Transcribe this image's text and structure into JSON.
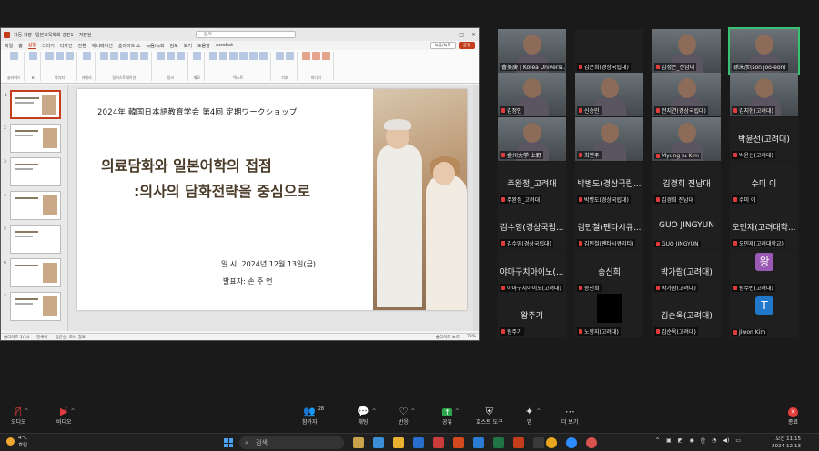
{
  "ppt": {
    "autosave": "자동 저장",
    "filename": "일본교육학회 강진1 • 저장됨",
    "search_placeholder": "검색",
    "tabs": [
      "파일",
      "홈",
      "삽입",
      "그리기",
      "디자인",
      "전환",
      "애니메이션",
      "슬라이드 쇼",
      "녹음/녹화",
      "검토",
      "보기",
      "도움말",
      "Acrobat"
    ],
    "active_tab": "삽입",
    "record_button": "녹음/녹화",
    "share_button": "공유",
    "ribbon_groups": [
      "슬라이드",
      "표",
      "이미지",
      "카메라",
      "일러스트레이션",
      "링크",
      "메모",
      "텍스트",
      "기호",
      "미디어"
    ],
    "status_slide": "슬라이드 1/14",
    "status_lang": "한국어",
    "status_a11y": "접근성: 조사 필요",
    "status_notes": "슬라이드 노트",
    "status_zoom": "70%"
  },
  "slide": {
    "conference": "2024年  韓国日本語教育学会  第4回  定期ワークショップ",
    "title_line1": "의료담화와 일본어학의 접점",
    "title_line2": ":의사의 담화전략을 중심으로",
    "date_line": "일   시: 2024년 12월 13일(금)",
    "presenter_line": "발표자: 손 주 언"
  },
  "thumbnails": [
    "1",
    "2",
    "3",
    "4",
    "5",
    "6",
    "7"
  ],
  "gallery": {
    "tiles": [
      {
        "name": "",
        "label": "曹美庚 | Korea Universi...",
        "video": true,
        "muted": false,
        "speaking": false
      },
      {
        "name": "",
        "label": "김은희(경상국립대)",
        "video": false,
        "muted": true,
        "speaking": false
      },
      {
        "name": "",
        "label": "김성은_전남대",
        "video": true,
        "muted": true,
        "speaking": false
      },
      {
        "name": "",
        "label": "孫朱彦(son joo-eon)",
        "video": true,
        "muted": false,
        "speaking": true
      },
      {
        "name": "",
        "label": "김정인",
        "video": true,
        "muted": true,
        "speaking": false
      },
      {
        "name": "",
        "label": "신승민",
        "video": true,
        "muted": true,
        "speaking": false
      },
      {
        "name": "",
        "label": "전지연(경상국립대)",
        "video": true,
        "muted": true,
        "speaking": false
      },
      {
        "name": "",
        "label": "김지현(고려대)",
        "video": true,
        "muted": true,
        "speaking": false
      },
      {
        "name": "",
        "label": "金州大学  上野",
        "video": true,
        "muted": true,
        "speaking": false
      },
      {
        "name": "",
        "label": "최연주",
        "video": true,
        "muted": true,
        "speaking": false
      },
      {
        "name": "",
        "label": "Myung Ju Kim",
        "video": true,
        "muted": true,
        "speaking": false
      },
      {
        "name": "박윤선(고려대)",
        "label": "박윤선(고려대)",
        "video": false,
        "muted": true,
        "speaking": false
      },
      {
        "name": "주완정_고려대",
        "label": "주완정_고려대",
        "video": false,
        "muted": true,
        "speaking": false
      },
      {
        "name": "박병도(경상국립...",
        "label": "박병도(경상국립대)",
        "video": false,
        "muted": true,
        "speaking": false
      },
      {
        "name": "김경희 전남대",
        "label": "김경희 전남대",
        "video": false,
        "muted": true,
        "speaking": false
      },
      {
        "name": "수미 이",
        "label": "수미 이",
        "video": false,
        "muted": true,
        "speaking": false
      },
      {
        "name": "김수영(경상국립...",
        "label": "김수영(경상국립대)",
        "video": false,
        "muted": true,
        "speaking": false
      },
      {
        "name": "김민철(펜타시큐...",
        "label": "김민철(펜타시큐리티)",
        "video": false,
        "muted": true,
        "speaking": false
      },
      {
        "name": "GUO JINGYUN",
        "label": "GUO JINGYUN",
        "video": false,
        "muted": true,
        "speaking": false
      },
      {
        "name": "오민제(고려대학...",
        "label": "오민제(고려대학교)",
        "video": false,
        "muted": true,
        "speaking": false
      },
      {
        "name": "야마구치아이노(...",
        "label": "야마구치아이노(고려대)",
        "video": false,
        "muted": true,
        "speaking": false
      },
      {
        "name": "송신희",
        "label": "송신희",
        "video": false,
        "muted": true,
        "speaking": false
      },
      {
        "name": "박가람(고려대)",
        "label": "박가람(고려대)",
        "video": false,
        "muted": true,
        "speaking": false
      },
      {
        "name": "",
        "label": "왕수빈(고려대)",
        "video": false,
        "muted": true,
        "speaking": false,
        "letter": "왕",
        "letter_color": "#9b59b6"
      },
      {
        "name": "왕주기",
        "label": "왕주기",
        "video": false,
        "muted": true,
        "speaking": false
      },
      {
        "name": "",
        "label": "노향지(고려대)",
        "video": false,
        "muted": true,
        "speaking": false,
        "black": true
      },
      {
        "name": "김순옥(고려대)",
        "label": "김순옥(고려대)",
        "video": false,
        "muted": true,
        "speaking": false
      },
      {
        "name": "",
        "label": "Jiwon Kim",
        "video": false,
        "muted": true,
        "speaking": false,
        "letter": "T",
        "letter_color": "#1f78c9"
      }
    ]
  },
  "toolbar": {
    "audio": "오디오",
    "video": "비디오",
    "participants": "참가자",
    "participants_count": "28",
    "chat": "채팅",
    "reactions": "반응",
    "share": "공유",
    "host_tools": "호스트 도구",
    "apps": "앱",
    "more": "더 보기",
    "end": "종료"
  },
  "taskbar": {
    "temperature": "4°C",
    "weather": "흐림",
    "search": "검색",
    "lang": "한",
    "time": "오전 11:15",
    "date": "2024-12-13"
  }
}
